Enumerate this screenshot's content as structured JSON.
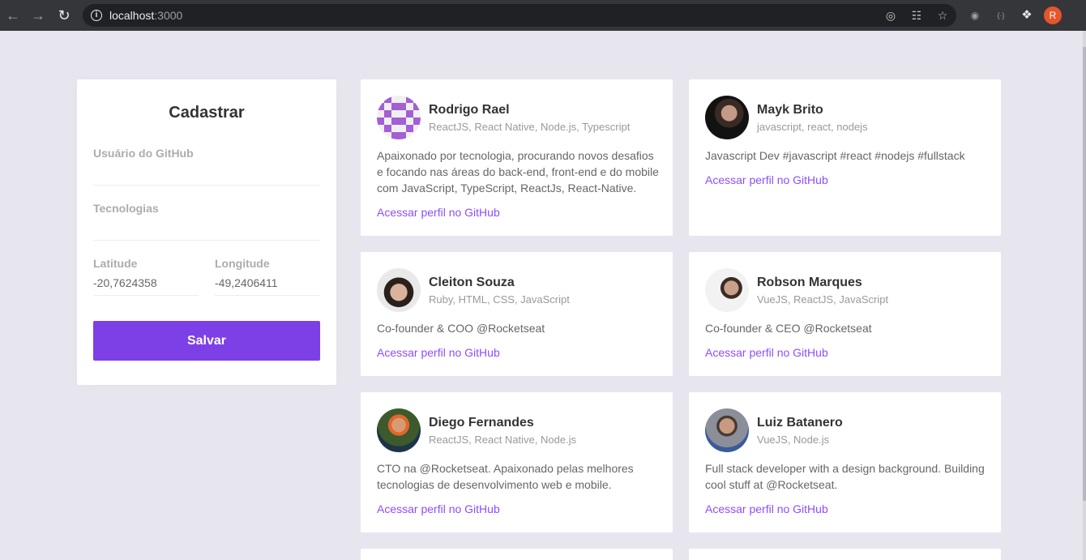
{
  "browser": {
    "url_host": "localhost",
    "url_port": ":3000",
    "profile_initial": "R",
    "icons": [
      "back-icon",
      "forward-icon",
      "reload-icon",
      "site-info-icon",
      "location-icon",
      "translate-icon",
      "bookmark-star-icon",
      "extension-icon",
      "json-viewer-icon",
      "puzzle-icon"
    ]
  },
  "form": {
    "title": "Cadastrar",
    "github_label": "Usuário do GitHub",
    "github_value": "",
    "techs_label": "Tecnologias",
    "techs_value": "",
    "latitude_label": "Latitude",
    "latitude_value": "-20,7624358",
    "longitude_label": "Longitude",
    "longitude_value": "-49,2406411",
    "save_label": "Salvar"
  },
  "devs": [
    {
      "name": "Rodrigo Rael",
      "techs": "ReactJS, React Native, Node.js, Typescript",
      "bio": "Apaixonado por tecnologia, procurando novos desafios e focando nas áreas do back-end, front-end e do mobile com JavaScript, TypeScript, ReactJs, React-Native.",
      "link": "Acessar perfil no GitHub"
    },
    {
      "name": "Mayk Brito",
      "techs": "javascript, react, nodejs",
      "bio": "Javascript Dev #javascript #react #nodejs #fullstack",
      "link": "Acessar perfil no GitHub"
    },
    {
      "name": "Cleiton Souza",
      "techs": "Ruby, HTML, CSS, JavaScript",
      "bio": "Co-founder & COO @Rocketseat",
      "link": "Acessar perfil no GitHub"
    },
    {
      "name": "Robson Marques",
      "techs": "VueJS, ReactJS, JavaScript",
      "bio": "Co-founder & CEO @Rocketseat",
      "link": "Acessar perfil no GitHub"
    },
    {
      "name": "Diego Fernandes",
      "techs": "ReactJS, React Native, Node.js",
      "bio": "CTO na @Rocketseat. Apaixonado pelas melhores tecnologias de desenvolvimento web e mobile.",
      "link": "Acessar perfil no GitHub"
    },
    {
      "name": "Luiz Batanero",
      "techs": "VueJS, Node.js",
      "bio": "Full stack developer with a design background. Building cool stuff at @Rocketseat.",
      "link": "Acessar perfil no GitHub"
    }
  ],
  "colors": {
    "page_bg": "#e7e6ef",
    "accent": "#7d40e7",
    "link": "#8e4dff"
  }
}
